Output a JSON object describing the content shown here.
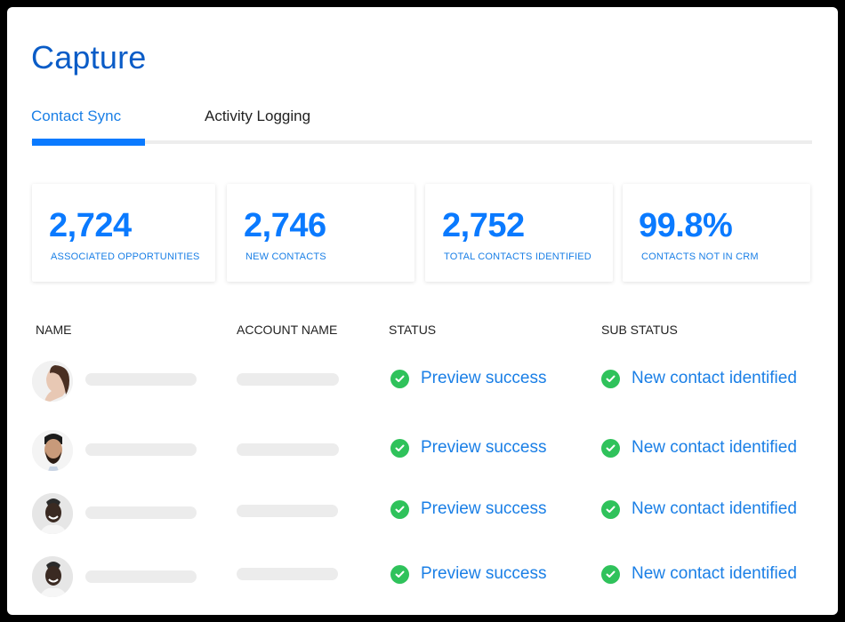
{
  "header": {
    "title": "Capture"
  },
  "tabs": [
    {
      "label": "Contact Sync",
      "active": true
    },
    {
      "label": "Activity Logging",
      "active": false
    }
  ],
  "stats": [
    {
      "value": "2,724",
      "label": "ASSOCIATED OPPORTUNITIES"
    },
    {
      "value": "2,746",
      "label": "NEW CONTACTS"
    },
    {
      "value": "2,752",
      "label": "TOTAL CONTACTS IDENTIFIED"
    },
    {
      "value": "99.8%",
      "label": "CONTACTS NOT IN CRM"
    }
  ],
  "table": {
    "columns": [
      "NAME",
      "ACCOUNT NAME",
      "STATUS",
      "SUB STATUS"
    ],
    "rows": [
      {
        "avatar": "woman-profile-photo",
        "status": "Preview success",
        "sub_status": "New contact identified"
      },
      {
        "avatar": "bearded-man-photo",
        "status": "Preview success",
        "sub_status": "New contact identified"
      },
      {
        "avatar": "smiling-man-photo",
        "status": "Preview success",
        "sub_status": "New contact identified"
      },
      {
        "avatar": "smiling-man-photo",
        "status": "Preview success",
        "sub_status": "New contact identified"
      }
    ]
  },
  "colors": {
    "accent": "#0a7aff",
    "title": "#0a5cc7",
    "success": "#2fc25b",
    "skeleton": "#ececec"
  }
}
